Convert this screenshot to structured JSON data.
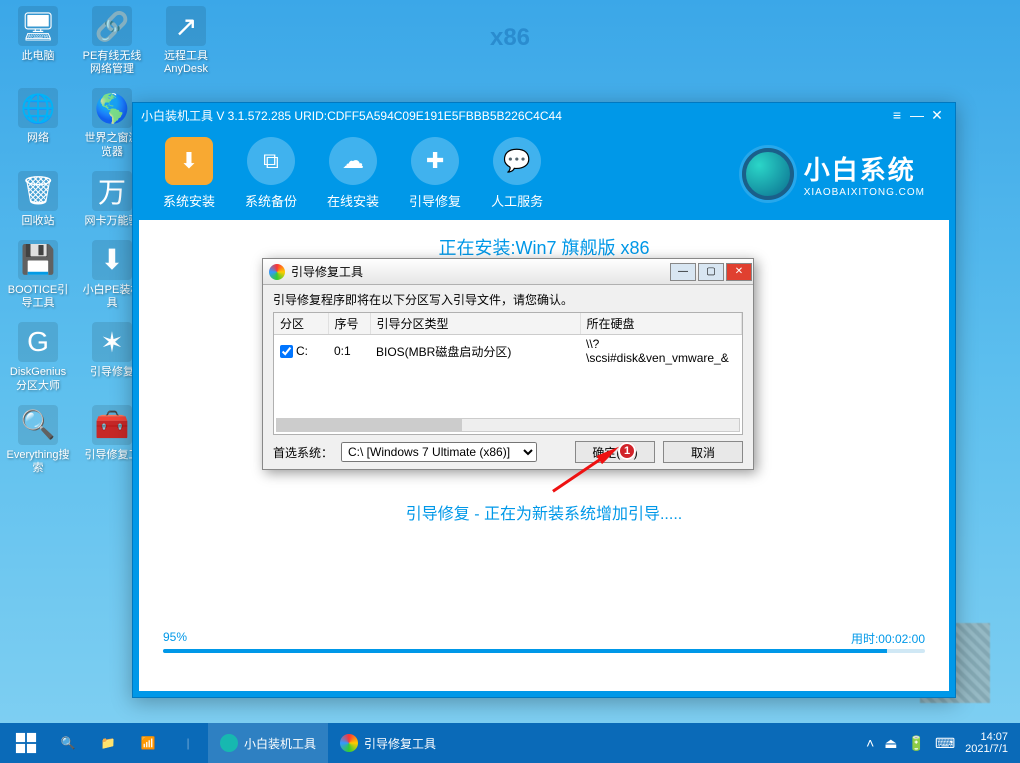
{
  "desktop": {
    "watermark": "x86",
    "icons": [
      {
        "label": "此电脑",
        "glyph": "🖥"
      },
      {
        "label": "PE有线无线网络管理",
        "glyph": "🔗"
      },
      {
        "label": "远程工具AnyDesk",
        "glyph": "↗"
      },
      {
        "label": "网络",
        "glyph": "🌐"
      },
      {
        "label": "世界之窗浏览器",
        "glyph": "🌎"
      },
      {
        "label": "",
        "glyph": ""
      },
      {
        "label": "回收站",
        "glyph": "🗑"
      },
      {
        "label": "网卡万能驱",
        "glyph": "万"
      },
      {
        "label": "",
        "glyph": ""
      },
      {
        "label": "BOOTICE引导工具",
        "glyph": "💾"
      },
      {
        "label": "小白PE装机具",
        "glyph": "⬇"
      },
      {
        "label": "",
        "glyph": ""
      },
      {
        "label": "DiskGenius分区大师",
        "glyph": "G"
      },
      {
        "label": "引导修复",
        "glyph": "✶"
      },
      {
        "label": "",
        "glyph": ""
      },
      {
        "label": "Everything搜索",
        "glyph": "🔍"
      },
      {
        "label": "引导修复工",
        "glyph": "🧰"
      }
    ]
  },
  "app": {
    "title": "小白装机工具 V 3.1.572.285 URID:CDFF5A594C09E191E5FBBB5B226C4C44",
    "toolbar": [
      {
        "label": "系统安装",
        "glyph": "⬇"
      },
      {
        "label": "系统备份",
        "glyph": "⧉"
      },
      {
        "label": "在线安装",
        "glyph": "☁"
      },
      {
        "label": "引导修复",
        "glyph": "✚"
      },
      {
        "label": "人工服务",
        "glyph": "💬"
      }
    ],
    "brand": {
      "name": "小白系统",
      "sub": "XIAOBAIXITONG.COM"
    },
    "installing": "正在安装:Win7 旗舰版 x86",
    "status": "引导修复 - 正在为新装系统增加引导.....",
    "progress": {
      "pct": "95%",
      "time_label": "用时:",
      "time": "00:02:00",
      "fill": 95
    }
  },
  "dialog": {
    "title": "引导修复工具",
    "message": "引导修复程序即将在以下分区写入引导文件，请您确认。",
    "columns": [
      "分区",
      "序号",
      "引导分区类型",
      "所在硬盘"
    ],
    "row": {
      "part": "C:",
      "idx": "0:1",
      "type": "BIOS(MBR磁盘启动分区)",
      "disk": "\\\\?\\scsi#disk&ven_vmware_&"
    },
    "prefer_label": "首选系统：",
    "prefer_value": "C:\\ [Windows 7 Ultimate (x86)]",
    "ok": "确定(15)",
    "cancel": "取消",
    "badge": "1"
  },
  "taskbar": {
    "tasks": [
      {
        "label": "小白装机工具",
        "color": "#17b8b0"
      },
      {
        "label": "引导修复工具",
        "color": ""
      }
    ],
    "clock": {
      "time": "14:07",
      "date": "2021/7/1"
    }
  }
}
